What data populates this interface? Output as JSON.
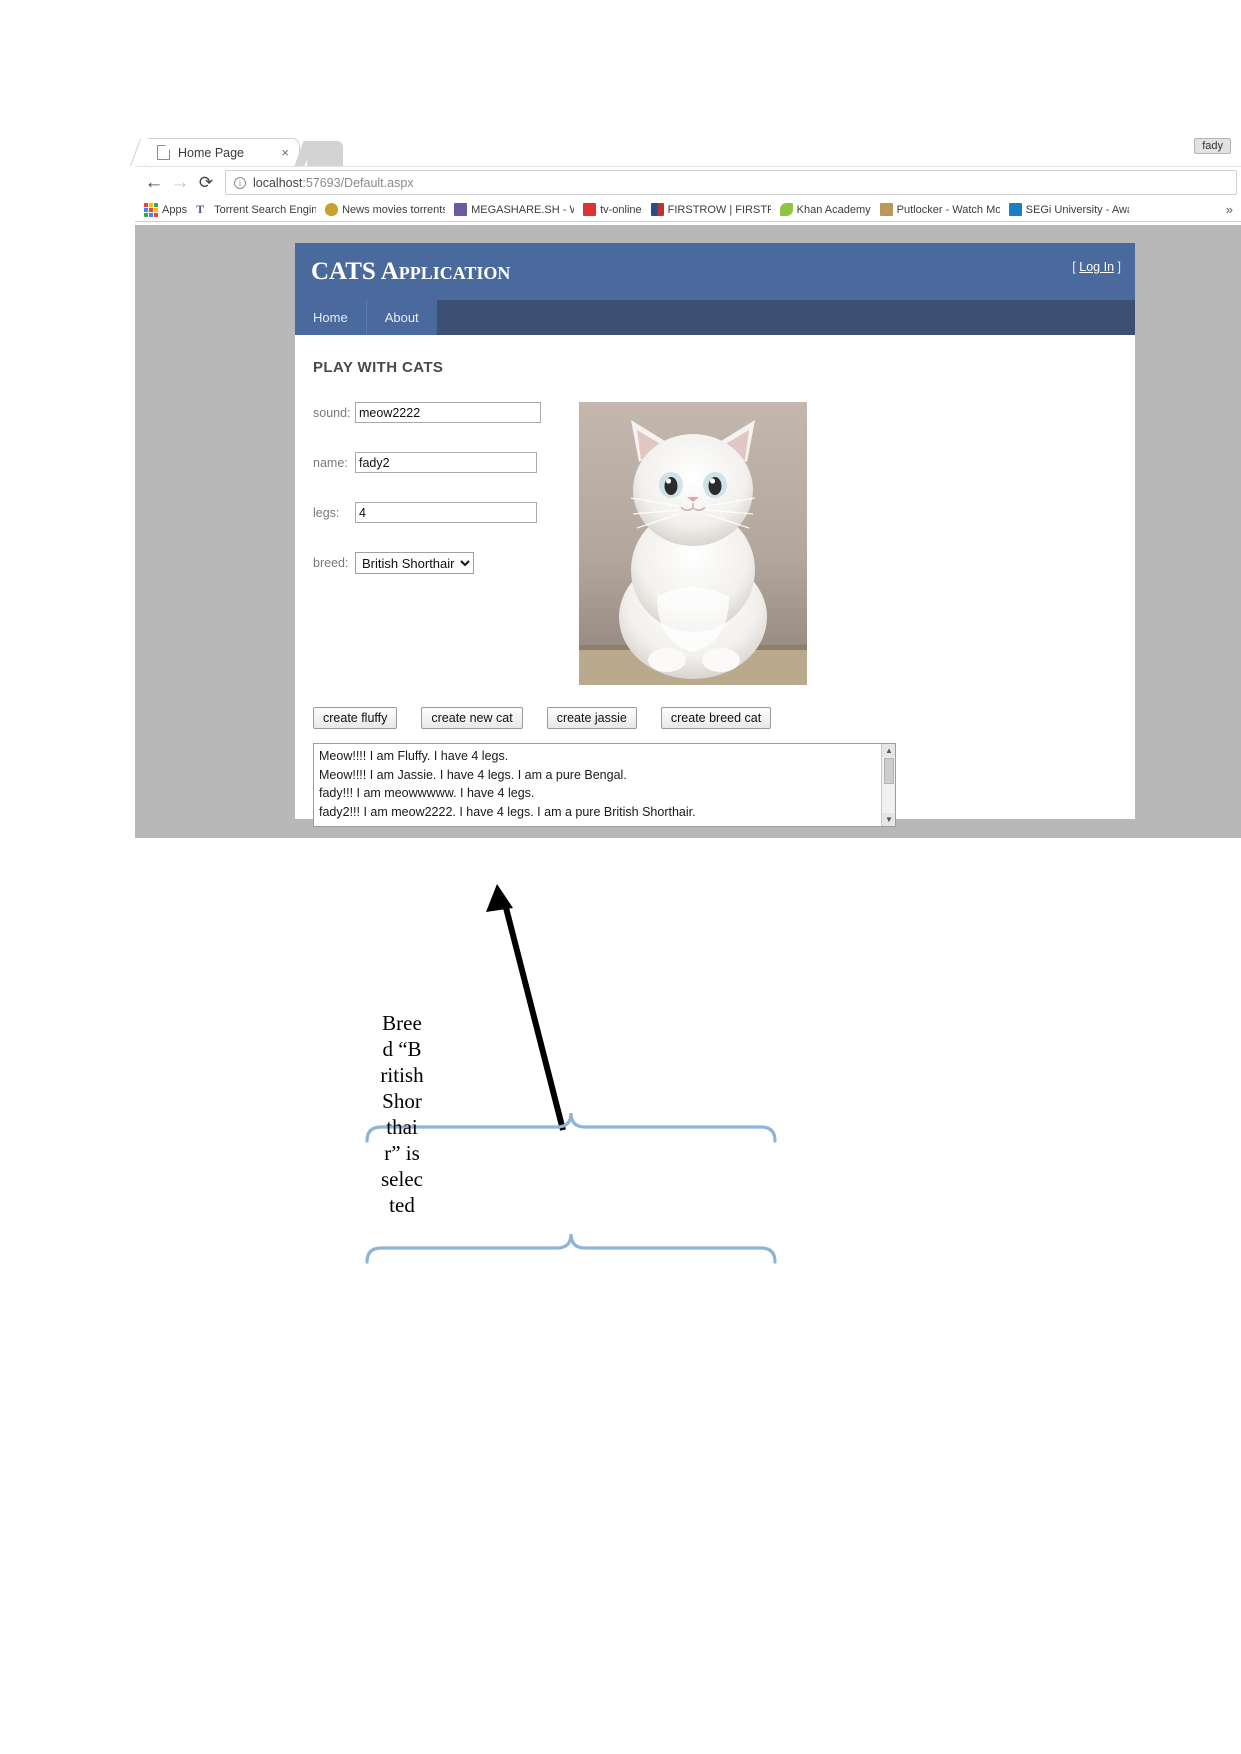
{
  "browser": {
    "tab": {
      "title": "Home Page",
      "close_label": "×",
      "favicon": "page-icon"
    },
    "nav": {
      "back": "←",
      "forward": "→",
      "reload": "⟳"
    },
    "omnibox": {
      "info_icon": "i",
      "url_strong": "localhost",
      "url_rest": ":57693/Default.aspx"
    },
    "bookmarks": {
      "more": "»",
      "items": [
        {
          "label": "Apps",
          "icon": "apps-grid-icon"
        },
        {
          "label": "Torrent Search Engine",
          "icon": "torrent-icon"
        },
        {
          "label": "News movies torrents",
          "icon": "shield-icon"
        },
        {
          "label": "MEGASHARE.SH - Wa",
          "icon": "megashare-icon"
        },
        {
          "label": "tv-online",
          "icon": "tv-icon"
        },
        {
          "label": "FIRSTROW | FIRSTROW",
          "icon": "firstrow-icon"
        },
        {
          "label": "Khan Academy",
          "icon": "khan-leaf-icon"
        },
        {
          "label": "Putlocker - Watch Mo",
          "icon": "film-icon"
        },
        {
          "label": "SEGi University - Awa",
          "icon": "segi-icon"
        }
      ]
    },
    "user_badge": "fady"
  },
  "app": {
    "title": "CATS Application",
    "login_open": "[",
    "login_label": "Log In",
    "login_close": "]",
    "nav": [
      {
        "label": "Home"
      },
      {
        "label": "About"
      }
    ],
    "section_title": "PLAY WITH CATS",
    "fields": [
      {
        "label": "sound:",
        "value": "meow2222",
        "name": "sound"
      },
      {
        "label": "name:",
        "value": "fady2",
        "name": "name"
      },
      {
        "label": "legs:",
        "value": "4",
        "name": "legs"
      }
    ],
    "breed": {
      "label": "breed:",
      "selected": "British Shorthair",
      "options": [
        "British Shorthair"
      ]
    },
    "photo_alt": "white fluffy kitten photo",
    "buttons": [
      {
        "label": "create fluffy"
      },
      {
        "label": "create new cat"
      },
      {
        "label": "create jassie"
      },
      {
        "label": "create breed cat"
      }
    ],
    "output_lines": [
      "Meow!!!! I am Fluffy. I have 4 legs.",
      "Meow!!!! I am Jassie. I have 4 legs. I am a pure Bengal.",
      "fady!!! I am meowwwww. I have 4 legs.",
      "fady2!!! I am meow2222. I have 4 legs. I am a pure British Shorthair."
    ],
    "scroll": {
      "up": "▲",
      "down": "▼"
    }
  },
  "annotation": {
    "text": "Breed “British Shorthair” is selected",
    "brace_color": "#8eb4d8",
    "arrow_color": "#000000"
  },
  "colors": {
    "header_blue": "#4a6a9e",
    "nav_blue": "#3b5073",
    "page_bg": "#b8b8b8",
    "brace": "#8eb4d8"
  }
}
